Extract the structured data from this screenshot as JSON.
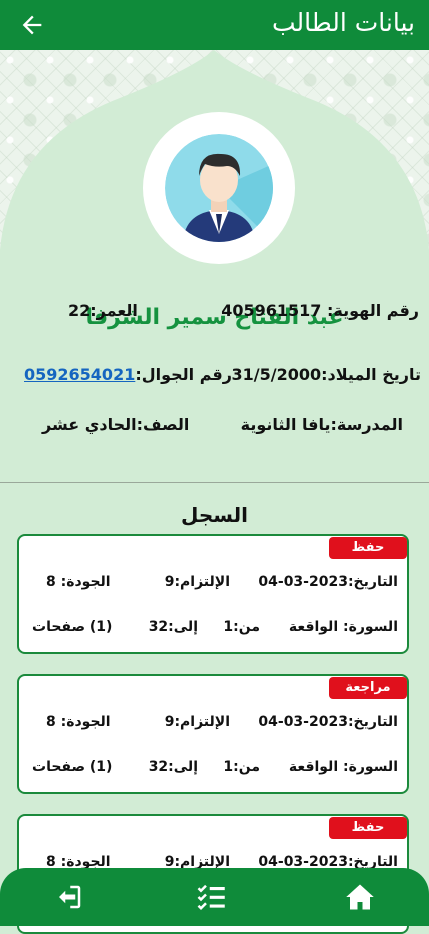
{
  "appbar": {
    "title": "بيانات الطالب"
  },
  "student": {
    "name": "عبد الفتاح سمير الشرفا",
    "id_label": "رقم الهوية:",
    "id_value": "405961517",
    "age": "العمر:22",
    "dob": "تاريخ الميلاد:31/5/2000",
    "phone_label": "رقم الجوال:",
    "phone_value": "0592654021",
    "school": "المدرسة:يافا الثانوية",
    "grade": "الصف:الحادي عشر"
  },
  "records_title": "السجل",
  "records": [
    {
      "badge": "حفظ",
      "date": "التاريخ:2023-03-04",
      "commitment": "الإلتزام:9",
      "quality": "الجودة: 8",
      "surah": "السورة: الواقعة",
      "from": "من:1",
      "to": "إلى:32",
      "pages": "(1) صفحات"
    },
    {
      "badge": "مراجعة",
      "date": "التاريخ:2023-03-04",
      "commitment": "الإلتزام:9",
      "quality": "الجودة: 8",
      "surah": "السورة: الواقعة",
      "from": "من:1",
      "to": "إلى:32",
      "pages": "(1) صفحات"
    },
    {
      "badge": "حفظ",
      "date": "التاريخ:2023-03-04",
      "commitment": "الإلتزام:9",
      "quality": "الجودة: 8"
    }
  ],
  "colors": {
    "primary": "#0f8b3a",
    "badge": "#e0101c",
    "name": "#15923f",
    "link": "#1565c0",
    "background": "#d2ecd5"
  },
  "icons": {
    "back": "arrow-left-icon",
    "logout": "logout-icon",
    "list": "checklist-icon",
    "home": "home-icon"
  }
}
